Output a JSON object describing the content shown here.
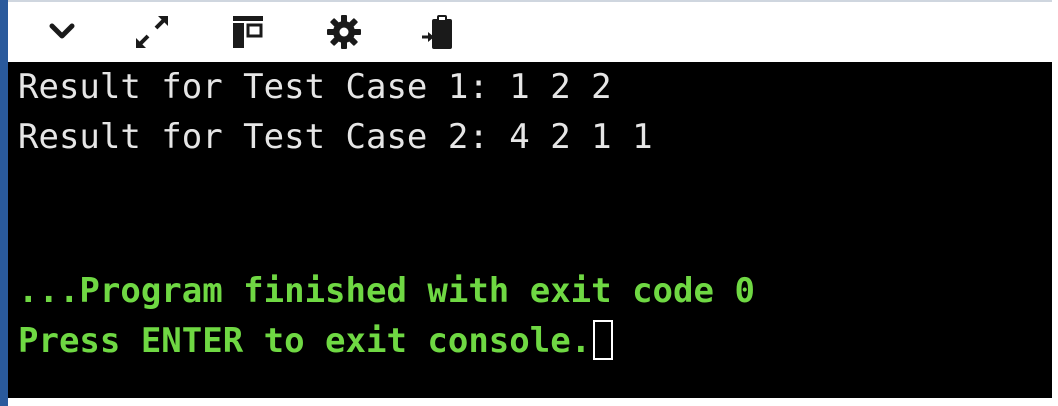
{
  "toolbar": {
    "buttons": [
      {
        "icon": "chevron-down-icon"
      },
      {
        "icon": "expand-icon"
      },
      {
        "icon": "layout-panel-icon"
      },
      {
        "icon": "gear-icon"
      },
      {
        "icon": "clipboard-input-icon"
      }
    ]
  },
  "console": {
    "output_lines": [
      "Result for Test Case 1: 1 2 2",
      "Result for Test Case 2: 4 2 1 1"
    ],
    "finish_message": "...Program finished with exit code 0",
    "prompt_message": "Press ENTER to exit console.",
    "colors": {
      "background": "#000000",
      "output_text": "#e6e6e6",
      "status_text": "#6fd843"
    }
  }
}
